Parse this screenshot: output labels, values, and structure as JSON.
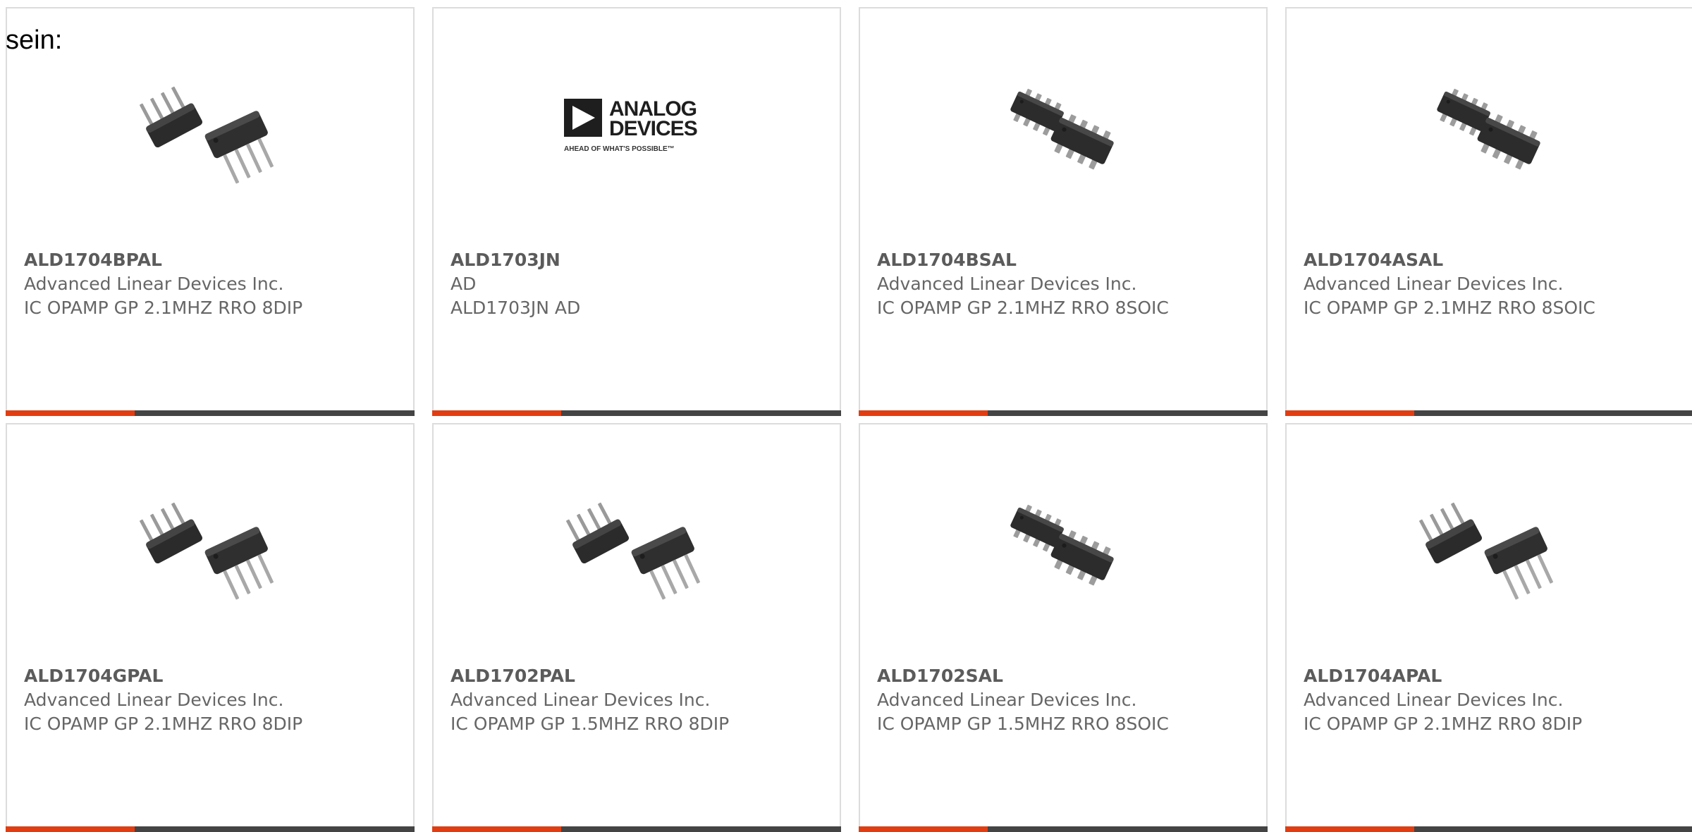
{
  "lead_text": "sein:",
  "colors": {
    "accent": "#e23d12",
    "bar": "#444444",
    "border": "#dcdcdc",
    "text": "#666666"
  },
  "products": [
    {
      "part_number": "ALD1704BPAL",
      "manufacturer": "Advanced Linear Devices Inc.",
      "description": "IC OPAMP GP 2.1MHZ RRO 8DIP",
      "image": "dip-package-icon"
    },
    {
      "part_number": "ALD1703JN",
      "manufacturer": "AD",
      "description": "ALD1703JN AD",
      "image": "analog-devices-logo",
      "logo_text": [
        "ANALOG",
        "DEVICES"
      ],
      "logo_tagline": "AHEAD OF WHAT'S POSSIBLE™"
    },
    {
      "part_number": "ALD1704BSAL",
      "manufacturer": "Advanced Linear Devices Inc.",
      "description": "IC OPAMP GP 2.1MHZ RRO 8SOIC",
      "image": "soic-package-icon"
    },
    {
      "part_number": "ALD1704ASAL",
      "manufacturer": "Advanced Linear Devices Inc.",
      "description": "IC OPAMP GP 2.1MHZ RRO 8SOIC",
      "image": "soic-package-icon"
    },
    {
      "part_number": "ALD1704GPAL",
      "manufacturer": "Advanced Linear Devices Inc.",
      "description": "IC OPAMP GP 2.1MHZ RRO 8DIP",
      "image": "dip-package-icon"
    },
    {
      "part_number": "ALD1702PAL",
      "manufacturer": "Advanced Linear Devices Inc.",
      "description": "IC OPAMP GP 1.5MHZ RRO 8DIP",
      "image": "dip-package-icon"
    },
    {
      "part_number": "ALD1702SAL",
      "manufacturer": "Advanced Linear Devices Inc.",
      "description": "IC OPAMP GP 1.5MHZ RRO 8SOIC",
      "image": "soic-package-icon"
    },
    {
      "part_number": "ALD1704APAL",
      "manufacturer": "Advanced Linear Devices Inc.",
      "description": "IC OPAMP GP 2.1MHZ RRO 8DIP",
      "image": "dip-package-icon"
    }
  ]
}
